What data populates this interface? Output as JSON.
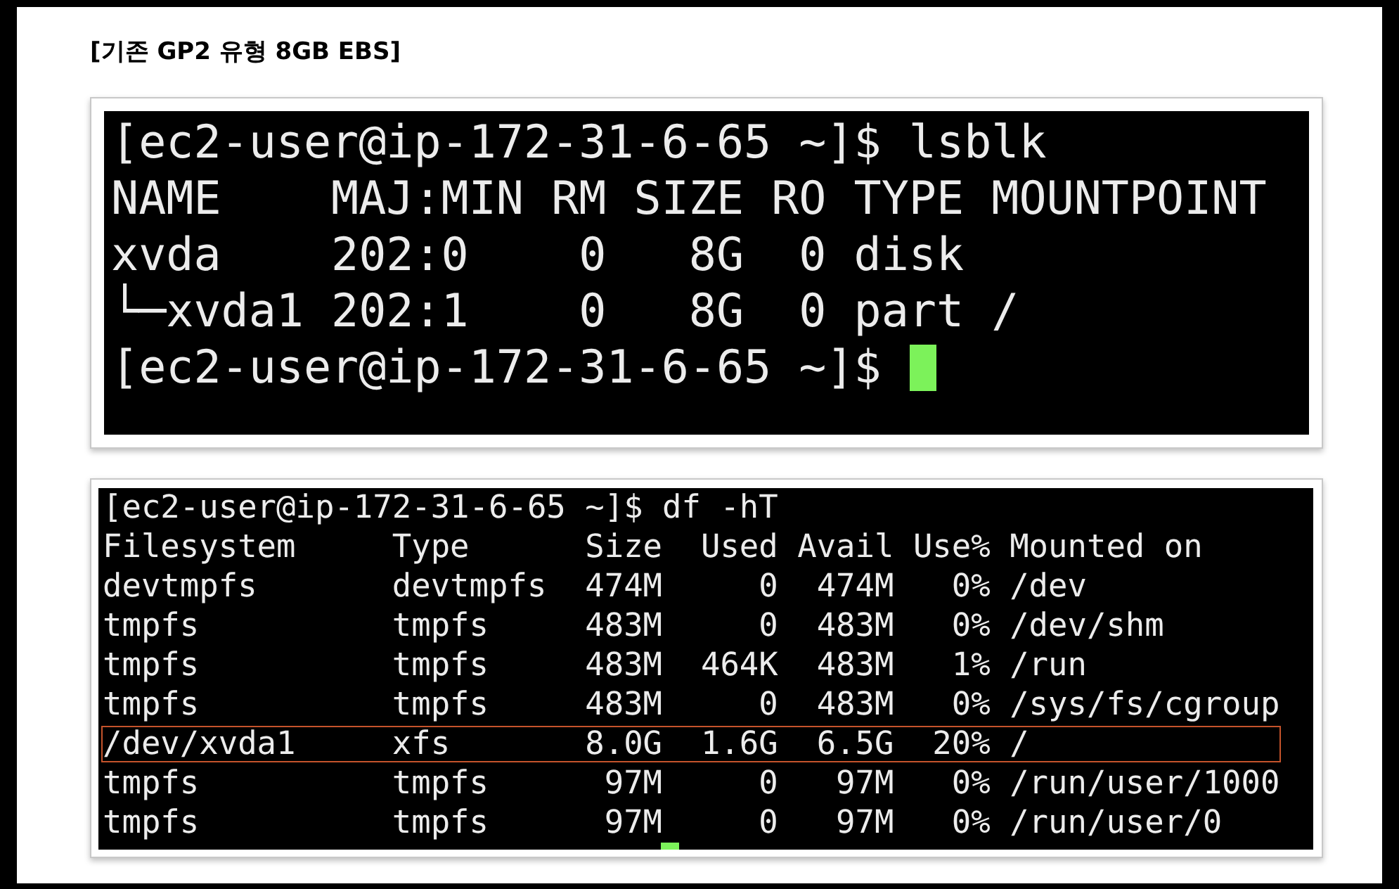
{
  "heading": "[기존 GP2 유형 8GB EBS]",
  "lsblk_terminal": {
    "cursor": true,
    "lines": [
      "[ec2-user@ip-172-31-6-65 ~]$ lsblk",
      "NAME    MAJ:MIN RM SIZE RO TYPE MOUNTPOINT",
      "xvda    202:0    0   8G  0 disk",
      "└─xvda1 202:1    0   8G  0 part /",
      "[ec2-user@ip-172-31-6-65 ~]$"
    ]
  },
  "df_terminal": {
    "cursor": true,
    "lines": [
      {
        "text": "[ec2-user@ip-172-31-6-65 ~]$ df -hT",
        "highlighted": false
      },
      {
        "text": "Filesystem     Type      Size  Used Avail Use% Mounted on",
        "highlighted": false
      },
      {
        "text": "devtmpfs       devtmpfs  474M     0  474M   0% /dev",
        "highlighted": false
      },
      {
        "text": "tmpfs          tmpfs     483M     0  483M   0% /dev/shm",
        "highlighted": false
      },
      {
        "text": "tmpfs          tmpfs     483M  464K  483M   1% /run",
        "highlighted": false
      },
      {
        "text": "tmpfs          tmpfs     483M     0  483M   0% /sys/fs/cgroup",
        "highlighted": false
      },
      {
        "text": "/dev/xvda1     xfs       8.0G  1.6G  6.5G  20% /",
        "highlighted": true
      },
      {
        "text": "tmpfs          tmpfs      97M     0   97M   0% /run/user/1000",
        "highlighted": false
      },
      {
        "text": "tmpfs          tmpfs      97M     0   97M   0% /run/user/0",
        "highlighted": false
      }
    ]
  }
}
